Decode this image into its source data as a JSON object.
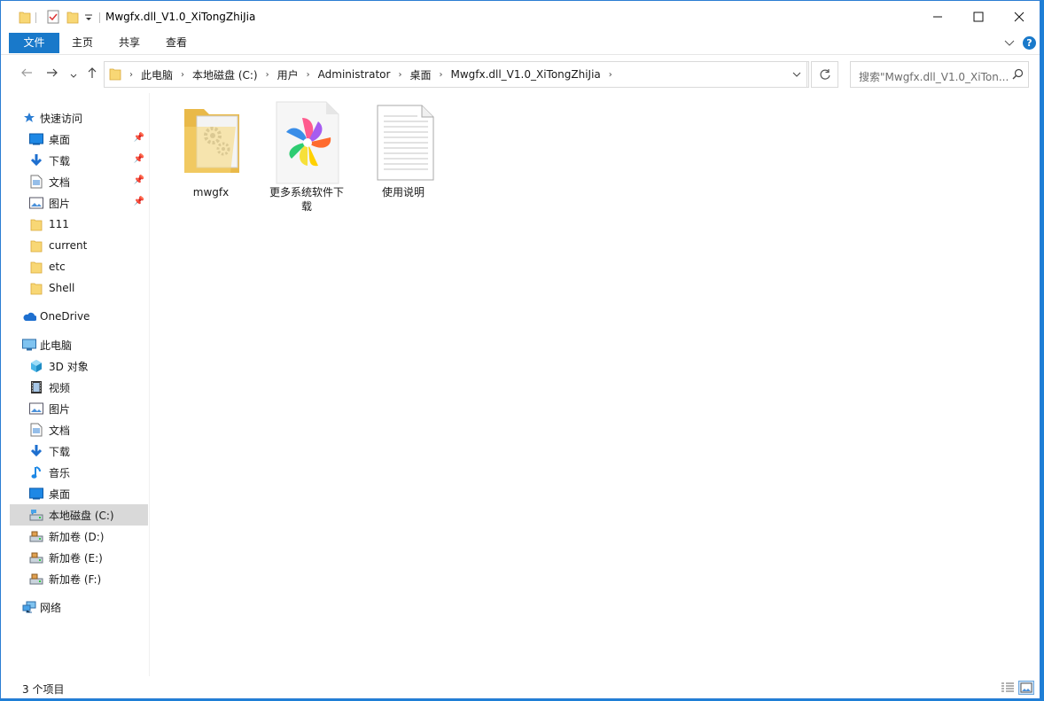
{
  "window": {
    "title": "Mwgfx.dll_V1.0_XiTongZhiJia"
  },
  "ribbon": {
    "tabs": [
      {
        "label": "文件",
        "active": true
      },
      {
        "label": "主页",
        "active": false
      },
      {
        "label": "共享",
        "active": false
      },
      {
        "label": "查看",
        "active": false
      }
    ]
  },
  "address": {
    "crumbs": [
      "此电脑",
      "本地磁盘 (C:)",
      "用户",
      "Administrator",
      "桌面",
      "Mwgfx.dll_V1.0_XiTongZhiJia"
    ]
  },
  "search": {
    "placeholder": "搜索\"Mwgfx.dll_V1.0_XiTon..."
  },
  "sidebar": {
    "quick_access": "快速访问",
    "quick_items": [
      {
        "label": "桌面",
        "icon": "desktop-icon",
        "pinned": true
      },
      {
        "label": "下载",
        "icon": "download-icon",
        "pinned": true
      },
      {
        "label": "文档",
        "icon": "document-icon",
        "pinned": true
      },
      {
        "label": "图片",
        "icon": "picture-icon",
        "pinned": true
      },
      {
        "label": "111",
        "icon": "folder-icon",
        "pinned": false
      },
      {
        "label": "current",
        "icon": "folder-icon",
        "pinned": false
      },
      {
        "label": "etc",
        "icon": "folder-icon",
        "pinned": false
      },
      {
        "label": "Shell",
        "icon": "folder-icon",
        "pinned": false
      }
    ],
    "onedrive": "OneDrive",
    "this_pc": "此电脑",
    "pc_items": [
      {
        "label": "3D 对象",
        "icon": "cube-icon"
      },
      {
        "label": "视频",
        "icon": "video-icon"
      },
      {
        "label": "图片",
        "icon": "picture-icon"
      },
      {
        "label": "文档",
        "icon": "document-icon"
      },
      {
        "label": "下载",
        "icon": "download-icon"
      },
      {
        "label": "音乐",
        "icon": "music-icon"
      },
      {
        "label": "桌面",
        "icon": "desktop-icon"
      },
      {
        "label": "本地磁盘 (C:)",
        "icon": "drive-icon",
        "selected": true
      },
      {
        "label": "新加卷 (D:)",
        "icon": "drive-icon"
      },
      {
        "label": "新加卷 (E:)",
        "icon": "drive-icon"
      },
      {
        "label": "新加卷 (F:)",
        "icon": "drive-icon"
      }
    ],
    "network": "网络"
  },
  "files": [
    {
      "name": "mwgfx",
      "type": "folder"
    },
    {
      "name": "更多系统软件下载",
      "type": "app"
    },
    {
      "name": "使用说明",
      "type": "text"
    }
  ],
  "status": {
    "count": "3 个项目"
  },
  "colors": {
    "accent": "#1979ca",
    "selection": "#d9d9d9",
    "folder": "#f8d775"
  }
}
